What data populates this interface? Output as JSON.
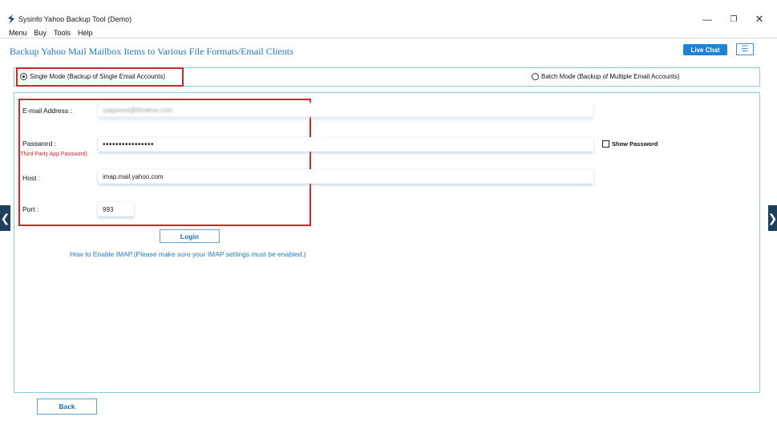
{
  "window": {
    "title": "Sysinfo Yahoo Backup Tool (Demo)",
    "app_icon": "sysinfo-logo-icon",
    "controls": {
      "minimize": "—",
      "restore": "❐",
      "close": "✕"
    }
  },
  "menu": {
    "items": [
      "Menu",
      "Buy",
      "Tools",
      "Help"
    ]
  },
  "header": {
    "title": "Backup Yahoo Mail Mailbox Items to Various File Formats/Email Clients",
    "live_chat_label": "Live Chat",
    "hamburger_glyph": "☰"
  },
  "mode": {
    "single_label": "Single Mode (Backup of Single Email Accounts)",
    "batch_label": "Batch Mode (Backup of Multiple Email Accounts)",
    "selected": "single"
  },
  "form": {
    "email_label": "E-mail Address :",
    "email_value": "yaqueera@ttfcahoo.com",
    "password_label": "Password :",
    "password_hint": "(Third-Party App Password)",
    "password_value": "••••••••••••••••",
    "show_password_label": "Show Password",
    "host_label": "Host :",
    "host_value": "imap.mail.yahoo.com",
    "port_label": "Port :",
    "port_value": "993",
    "login_label": "Login",
    "imap_help": "How to Enable IMAP.(Please make sure your IMAP settings must be enabled.)"
  },
  "footer": {
    "back_label": "Back"
  },
  "side_nav": {
    "left_glyph": "❮",
    "right_glyph": "❯"
  },
  "colors": {
    "accent": "#1f79c6",
    "highlight": "#d6232a",
    "panel_border": "#8ccbe6",
    "live_chat_bg": "#1e82d6"
  }
}
